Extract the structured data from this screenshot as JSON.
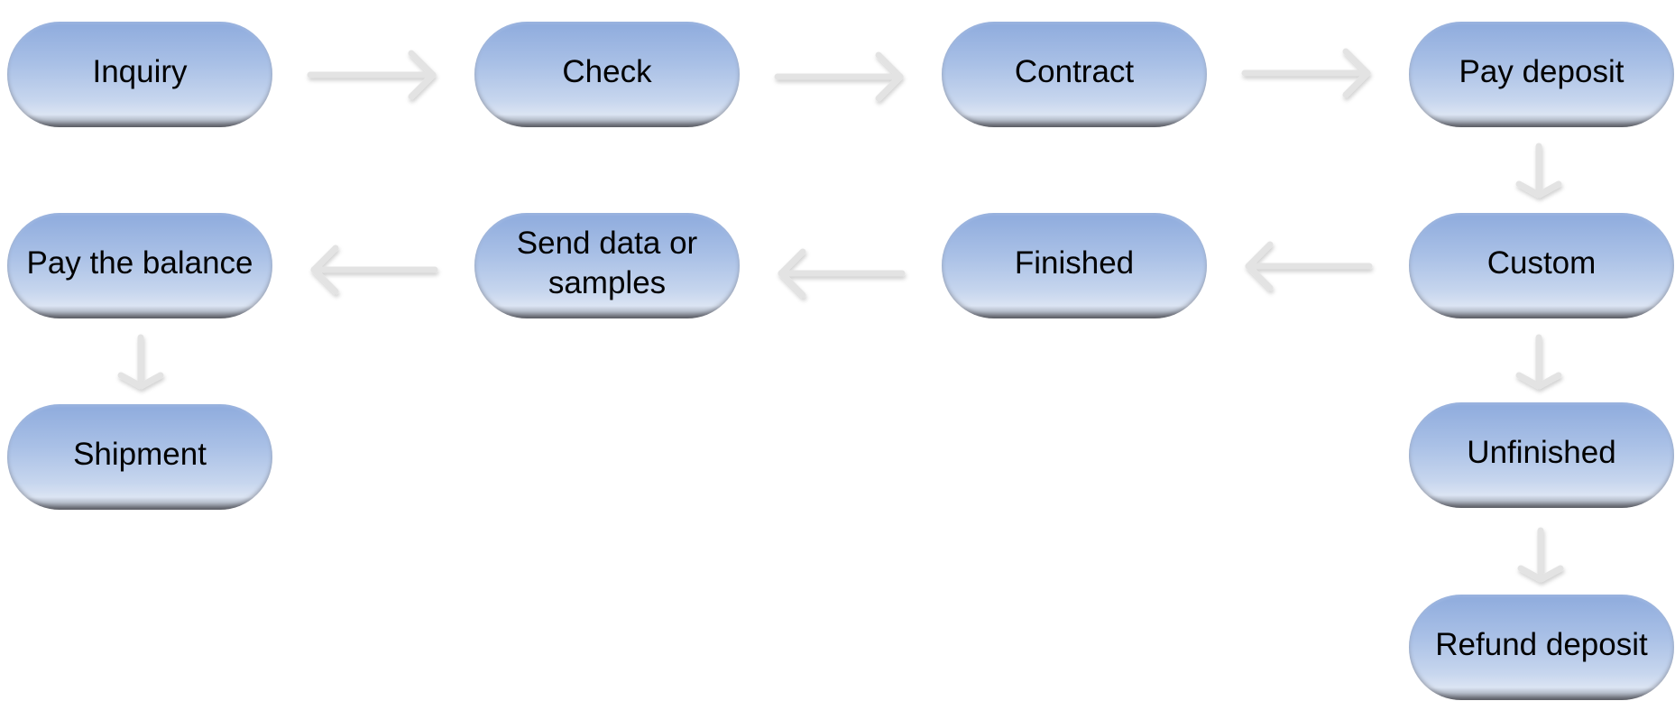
{
  "diagram": {
    "type": "flowchart",
    "nodes": [
      {
        "id": "inquiry",
        "label": "Inquiry"
      },
      {
        "id": "check",
        "label": "Check"
      },
      {
        "id": "contract",
        "label": "Contract"
      },
      {
        "id": "pay_deposit",
        "label": "Pay deposit"
      },
      {
        "id": "custom",
        "label": "Custom"
      },
      {
        "id": "finished",
        "label": "Finished"
      },
      {
        "id": "send_data",
        "label": "Send data or samples"
      },
      {
        "id": "pay_balance",
        "label": "Pay the balance"
      },
      {
        "id": "shipment",
        "label": "Shipment"
      },
      {
        "id": "unfinished",
        "label": "Unfinished"
      },
      {
        "id": "refund_deposit",
        "label": "Refund deposit"
      }
    ],
    "edges": [
      {
        "from": "inquiry",
        "to": "check",
        "direction": "right"
      },
      {
        "from": "check",
        "to": "contract",
        "direction": "right"
      },
      {
        "from": "contract",
        "to": "pay_deposit",
        "direction": "right"
      },
      {
        "from": "pay_deposit",
        "to": "custom",
        "direction": "down"
      },
      {
        "from": "custom",
        "to": "finished",
        "direction": "left"
      },
      {
        "from": "finished",
        "to": "send_data",
        "direction": "left"
      },
      {
        "from": "send_data",
        "to": "pay_balance",
        "direction": "left"
      },
      {
        "from": "pay_balance",
        "to": "shipment",
        "direction": "down"
      },
      {
        "from": "custom",
        "to": "unfinished",
        "direction": "down"
      },
      {
        "from": "unfinished",
        "to": "refund_deposit",
        "direction": "down"
      }
    ],
    "colors": {
      "node_top": "#8eabdd",
      "node_bottom": "#dbe4f3",
      "node_rim": "#6a6d73",
      "arrow": "#e3e3e3",
      "text": "#000000"
    }
  }
}
